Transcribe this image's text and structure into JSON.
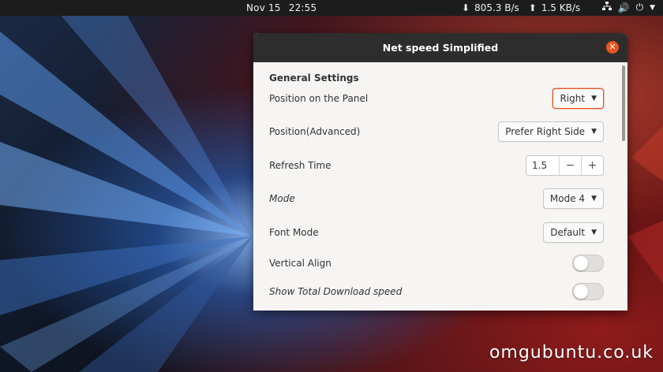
{
  "topbar": {
    "date": "Nov 15",
    "time": "22:55",
    "download_icon": "arrow-down-icon",
    "download_speed": "805.3 B/s",
    "upload_icon": "arrow-up-icon",
    "upload_speed": "1.5 KB/s",
    "tray_icons": [
      "network-icon",
      "volume-icon",
      "power-icon"
    ]
  },
  "dialog": {
    "title": "Net speed Simplified",
    "close_icon": "close-icon",
    "section_title": "General Settings",
    "rows": {
      "position_panel": {
        "label": "Position on the Panel",
        "value": "Right"
      },
      "position_advanced": {
        "label": "Position(Advanced)",
        "value": "Prefer Right Side"
      },
      "refresh_time": {
        "label": "Refresh Time",
        "value": "1.5",
        "minus": "−",
        "plus": "+"
      },
      "mode": {
        "label": "Mode",
        "value": "Mode 4"
      },
      "font_mode": {
        "label": "Font Mode",
        "value": "Default"
      },
      "vertical_align": {
        "label": "Vertical Align",
        "state": "off"
      },
      "show_total_download": {
        "label": "Show Total Download speed",
        "state": "off"
      }
    }
  },
  "watermark": {
    "text": "omgubuntu.co.uk"
  },
  "colors": {
    "accent": "#e95420",
    "topbar": "#1c1c1c",
    "titlebar": "#2d2d2d",
    "dialog_bg": "#f6f5f4"
  }
}
